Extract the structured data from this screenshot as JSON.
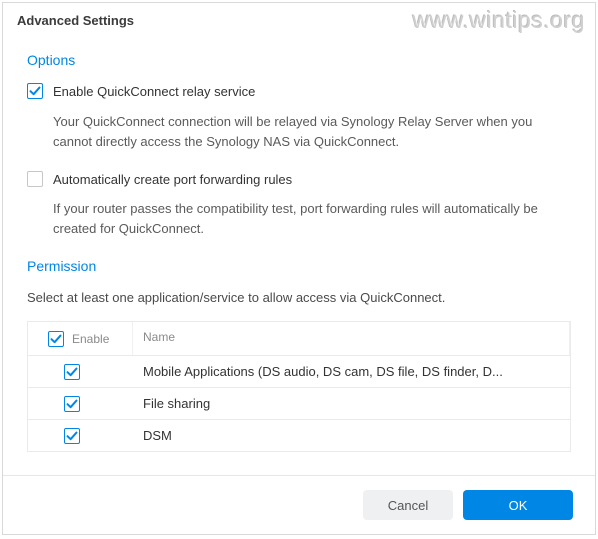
{
  "watermark": "www.wintips.org",
  "title": "Advanced Settings",
  "options": {
    "heading": "Options",
    "relay": {
      "checked": true,
      "label": "Enable QuickConnect relay service",
      "desc": "Your QuickConnect connection will be relayed via Synology Relay Server when you cannot directly access the Synology NAS via QuickConnect."
    },
    "portfwd": {
      "checked": false,
      "label": "Automatically create port forwarding rules",
      "desc": "If your router passes the compatibility test, port forwarding rules will automatically be created for QuickConnect."
    }
  },
  "permission": {
    "heading": "Permission",
    "desc": "Select at least one application/service to allow access via QuickConnect.",
    "columns": {
      "enable": "Enable",
      "name": "Name"
    },
    "header_checked": true,
    "rows": [
      {
        "checked": true,
        "name": "Mobile Applications (DS audio, DS cam, DS file, DS finder, D..."
      },
      {
        "checked": true,
        "name": "File sharing"
      },
      {
        "checked": true,
        "name": "DSM"
      }
    ]
  },
  "buttons": {
    "cancel": "Cancel",
    "ok": "OK"
  },
  "colors": {
    "accent": "#0086e5"
  }
}
